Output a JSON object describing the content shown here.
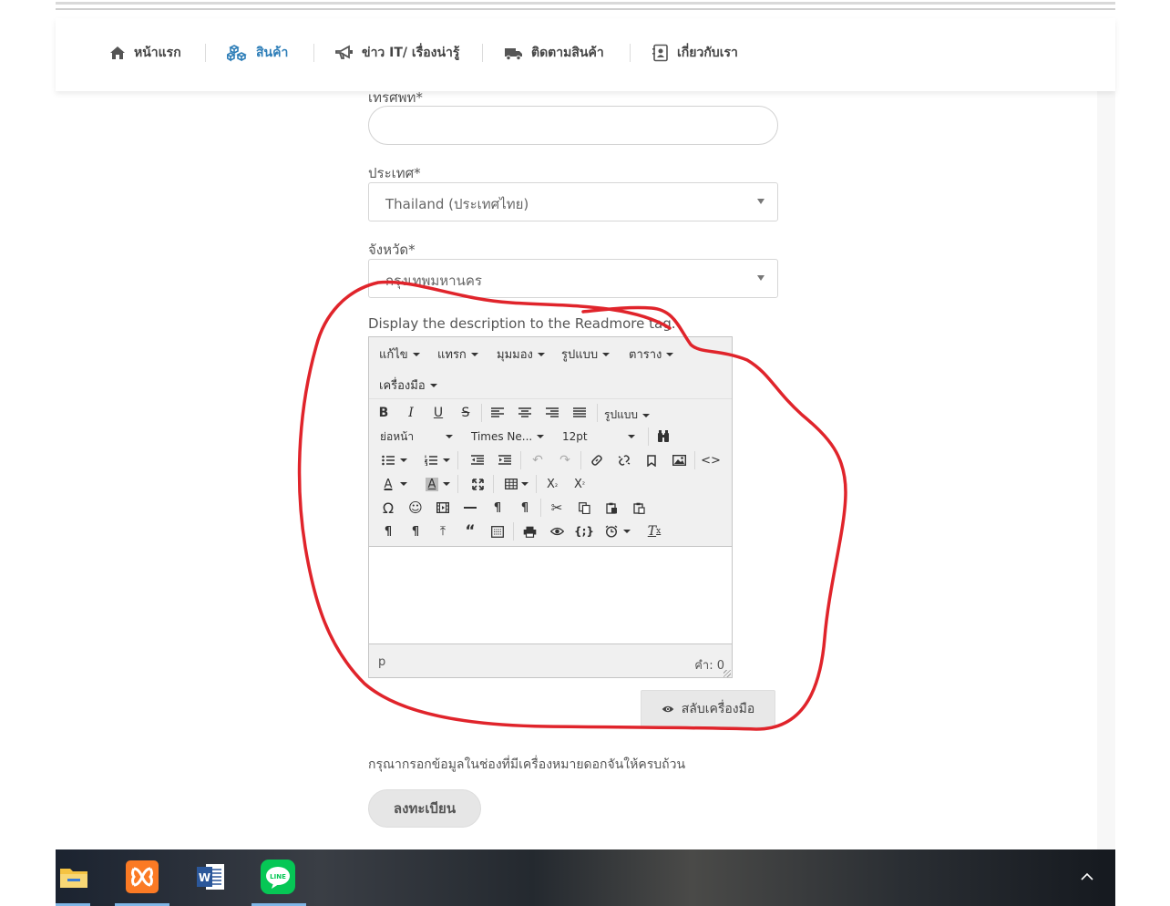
{
  "nav": {
    "items": [
      {
        "label": "หน้าแรก",
        "icon": "home-icon"
      },
      {
        "label": "สินค้า",
        "icon": "cubes-icon",
        "active": true
      },
      {
        "label": "ข่าว IT/ เรื่องน่ารู้",
        "icon": "megaphone-icon"
      },
      {
        "label": "ติดตามสินค้า",
        "icon": "truck-icon"
      },
      {
        "label": "เกี่ยวกับเรา",
        "icon": "contact-card-icon"
      }
    ],
    "active_color": "#2e7eb8"
  },
  "form": {
    "phone_label": "เทรศพท*",
    "country_label": "ประเทศ*",
    "country_value": "Thailand (ประเทศไทย)",
    "province_label": "จังหวัด*",
    "province_value": "กรุงเทพมหานคร",
    "description_label": "Display the description to the Readmore tag.",
    "note": "กรุณากรอกข้อมูลในช่องที่มีเครื่องหมายดอกจันให้ครบถ้วน",
    "register_button": "ลงทะเบียน",
    "toggle_button": "สลับเครื่องมือ"
  },
  "editor": {
    "menus": [
      "แก้ไข",
      "แทรก",
      "มุมมอง",
      "รูปแบบ",
      "ตาราง",
      "เครื่องมือ"
    ],
    "formats_label": "รูปแบบ",
    "block_format": "ย่อหน้า",
    "font_family": "Times Ne...",
    "font_size": "12pt",
    "status_path": "p",
    "word_count": "คำ: 0"
  },
  "annotation_color": "#e0242b"
}
